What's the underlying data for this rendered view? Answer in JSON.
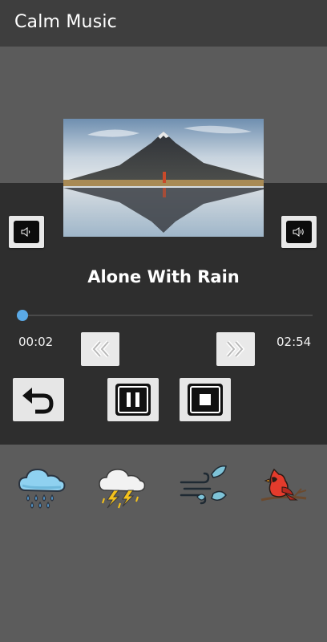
{
  "app": {
    "title": "Calm Music"
  },
  "player": {
    "track_title": "Alone With Rain",
    "current_time": "00:02",
    "total_time": "02:54",
    "progress": 0.011,
    "accent_color": "#5aa9e6"
  },
  "controls": {
    "volume_down_icon": "volume-down-icon",
    "volume_up_icon": "volume-up-icon",
    "rewind_icon": "rewind-icon",
    "fast_forward_icon": "fast-forward-icon",
    "repeat_icon": "repeat-icon",
    "pause_icon": "pause-icon",
    "stop_icon": "stop-icon"
  },
  "sounds": [
    {
      "icon": "rain-cloud-icon"
    },
    {
      "icon": "thunderstorm-cloud-icon"
    },
    {
      "icon": "wind-leaves-icon"
    },
    {
      "icon": "bird-branch-icon"
    }
  ],
  "artwork": {
    "icon": "mountain-lake-artwork"
  }
}
